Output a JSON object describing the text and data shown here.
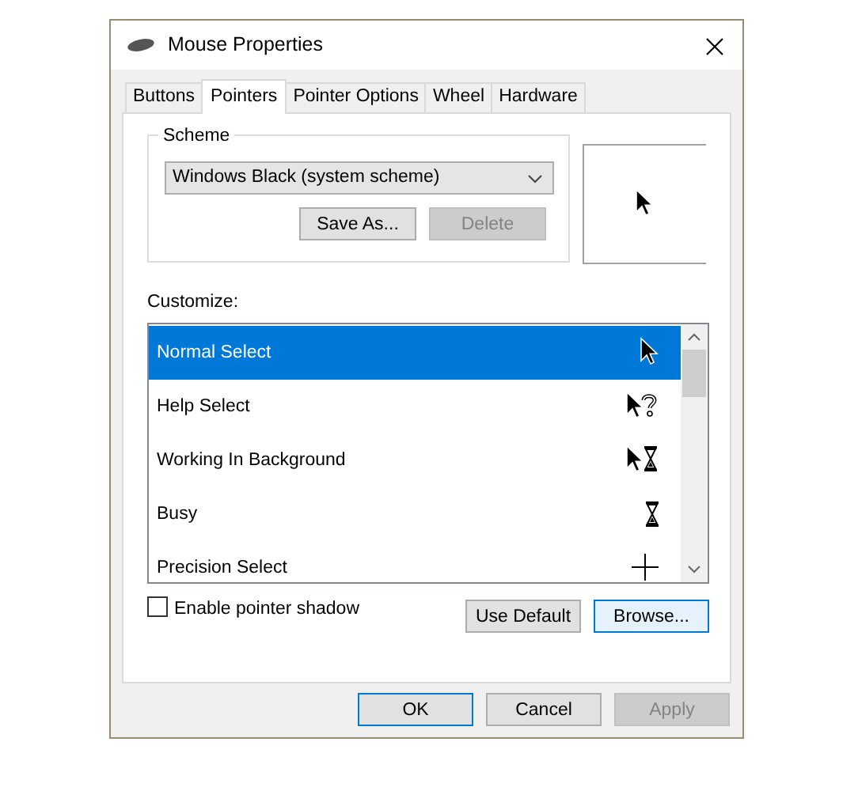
{
  "window": {
    "title": "Mouse Properties"
  },
  "tabs": [
    {
      "label": "Buttons",
      "selected": false
    },
    {
      "label": "Pointers",
      "selected": true
    },
    {
      "label": "Pointer Options",
      "selected": false
    },
    {
      "label": "Wheel",
      "selected": false
    },
    {
      "label": "Hardware",
      "selected": false
    }
  ],
  "scheme": {
    "label": "Scheme",
    "value": "Windows Black (system scheme)",
    "buttons": [
      {
        "label": "Save As...",
        "disabled": false
      },
      {
        "label": "Delete",
        "disabled": true
      }
    ]
  },
  "customize": {
    "label": "Customize:",
    "items": [
      {
        "name": "Normal Select",
        "kind": "arrow",
        "selected": true
      },
      {
        "name": "Help Select",
        "kind": "help",
        "selected": false
      },
      {
        "name": "Working In Background",
        "kind": "working",
        "selected": false
      },
      {
        "name": "Busy",
        "kind": "busy",
        "selected": false
      },
      {
        "name": "Precision Select",
        "kind": "cross",
        "selected": false
      }
    ]
  },
  "shadow": {
    "label": "Enable pointer shadow",
    "checked": false
  },
  "pointer_buttons": [
    {
      "label": "Use Default",
      "highlighted": false
    },
    {
      "label": "Browse...",
      "highlighted": true
    }
  ],
  "footer_buttons": [
    {
      "label": "OK",
      "highlighted": true,
      "disabled": false
    },
    {
      "label": "Cancel",
      "highlighted": false,
      "disabled": false
    },
    {
      "label": "Apply",
      "highlighted": false,
      "disabled": true
    }
  ]
}
